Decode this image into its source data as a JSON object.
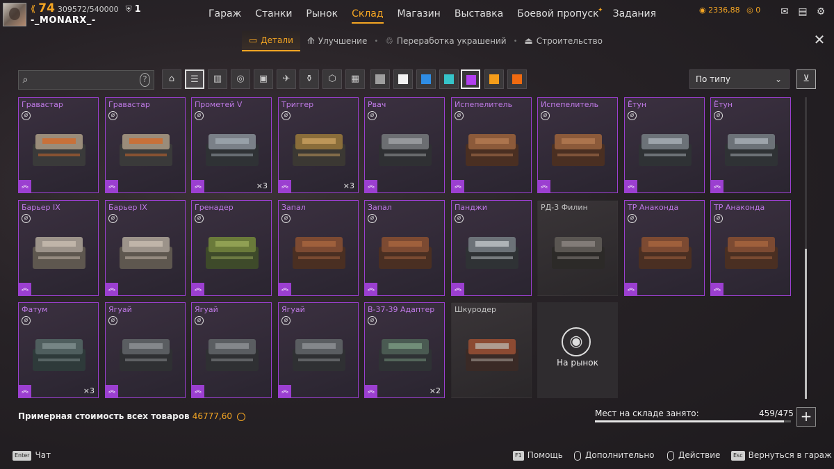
{
  "player": {
    "level": "74",
    "xp": "309572/540000",
    "badges": "1",
    "nickname": "-_MONARX_-"
  },
  "nav": {
    "items": [
      {
        "label": "Гараж"
      },
      {
        "label": "Станки"
      },
      {
        "label": "Рынок"
      },
      {
        "label": "Склад",
        "active": true
      },
      {
        "label": "Магазин"
      },
      {
        "label": "Выставка"
      },
      {
        "label": "Боевой пропуск"
      },
      {
        "label": "Задания"
      }
    ]
  },
  "currencies": {
    "coins": "2336,88",
    "secondary": "0"
  },
  "subnav": {
    "items": [
      {
        "label": "Детали",
        "icon": "crate-icon",
        "active": true
      },
      {
        "label": "Улучшение",
        "icon": "upgrade-icon"
      },
      {
        "label": "Переработка украшений",
        "icon": "recycle-icon"
      },
      {
        "label": "Строительство",
        "icon": "build-icon"
      }
    ]
  },
  "search": {
    "placeholder": "",
    "value": ""
  },
  "categories": [
    "cabin-icon",
    "weapons-icon",
    "modules-icon",
    "wheels-icon",
    "frames-icon",
    "drones-icon",
    "paint-icon",
    "decor-icon",
    "all-icon"
  ],
  "colors": [
    "#9e9e9e",
    "#f2f2f2",
    "#2f8de4",
    "#36c4c9",
    "#b23ff0",
    "#f59d1a",
    "#ef6a10"
  ],
  "active_color": "#b23ff0",
  "sort": {
    "selected": "По типу"
  },
  "items": [
    {
      "name": "Гравастар",
      "rarity": "epic",
      "count": ""
    },
    {
      "name": "Гравастар",
      "rarity": "epic",
      "count": ""
    },
    {
      "name": "Прометей V",
      "rarity": "epic",
      "count": "×3"
    },
    {
      "name": "Триггер",
      "rarity": "epic",
      "count": "×3"
    },
    {
      "name": "Рвач",
      "rarity": "epic",
      "count": ""
    },
    {
      "name": "Испепелитель",
      "rarity": "epic",
      "count": ""
    },
    {
      "name": "Испепелитель",
      "rarity": "epic",
      "count": ""
    },
    {
      "name": "Ётун",
      "rarity": "epic",
      "count": ""
    },
    {
      "name": "Ётун",
      "rarity": "epic",
      "count": ""
    },
    {
      "name": "Барьер IX",
      "rarity": "epic",
      "count": ""
    },
    {
      "name": "Барьер IX",
      "rarity": "epic",
      "count": ""
    },
    {
      "name": "Гренадер",
      "rarity": "epic",
      "count": ""
    },
    {
      "name": "Запал",
      "rarity": "epic",
      "count": ""
    },
    {
      "name": "Запал",
      "rarity": "epic",
      "count": ""
    },
    {
      "name": "Панджи",
      "rarity": "epic",
      "count": ""
    },
    {
      "name": "РД-3 Филин",
      "rarity": "none",
      "count": ""
    },
    {
      "name": "ТР Анаконда",
      "rarity": "epic",
      "count": ""
    },
    {
      "name": "ТР Анаконда",
      "rarity": "epic",
      "count": ""
    },
    {
      "name": "Фатум",
      "rarity": "epic",
      "count": "×3"
    },
    {
      "name": "Ягуай",
      "rarity": "epic",
      "count": ""
    },
    {
      "name": "Ягуай",
      "rarity": "epic",
      "count": ""
    },
    {
      "name": "Ягуай",
      "rarity": "epic",
      "count": ""
    },
    {
      "name": "В-37-39 Адаптер",
      "rarity": "epic",
      "count": "×2"
    },
    {
      "name": "Шкуродер",
      "rarity": "none",
      "count": ""
    }
  ],
  "market_tile": {
    "label": "На рынок"
  },
  "summary": {
    "cost_label": "Примерная стоимость всех товаров",
    "cost_value": "46777,60",
    "storage_label": "Мест на складе занято:",
    "storage_count": "459/475",
    "storage_fill": 0.966
  },
  "footer": {
    "chat_key": "Enter",
    "chat": "Чат",
    "help_key": "F1",
    "help": "Помощь",
    "more": "Дополнительно",
    "action": "Действие",
    "back_key": "Esc",
    "back": "Вернуться в гараж"
  }
}
